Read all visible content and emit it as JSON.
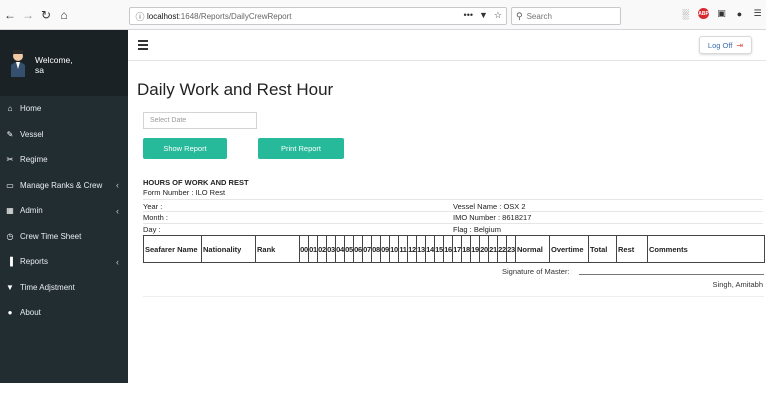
{
  "browser": {
    "back": "←",
    "forward": "→",
    "reload": "↻",
    "home": "⌂",
    "url_host": "localhost",
    "url_path": ":1648/Reports/DailyCrewReport",
    "url_more": "•••",
    "search_placeholder": "Search"
  },
  "sidebar": {
    "welcome_line1": "Welcome,",
    "welcome_line2": "sa",
    "items": [
      {
        "label": "Home",
        "icon": "home-icon",
        "glyph": "⌂",
        "chevron": ""
      },
      {
        "label": "Vessel",
        "icon": "edit-icon",
        "glyph": "✎",
        "chevron": ""
      },
      {
        "label": "Regime",
        "icon": "scissors-icon",
        "glyph": "✂",
        "chevron": ""
      },
      {
        "label": "Manage Ranks & Crew",
        "icon": "desktop-icon",
        "glyph": "▭",
        "chevron": "‹"
      },
      {
        "label": "Admin",
        "icon": "table-icon",
        "glyph": "▦",
        "chevron": "‹"
      },
      {
        "label": "Crew Time Sheet",
        "icon": "clock-icon",
        "glyph": "◷",
        "chevron": ""
      },
      {
        "label": "Reports",
        "icon": "bar-chart-icon",
        "glyph": "▐",
        "chevron": "‹"
      },
      {
        "label": "Time Adjstment",
        "icon": "filter-icon",
        "glyph": "▼",
        "chevron": ""
      },
      {
        "label": "About",
        "icon": "user-icon",
        "glyph": "●",
        "chevron": ""
      }
    ]
  },
  "header": {
    "logoff_label": "Log Off",
    "logoff_icon": "⇥"
  },
  "main": {
    "title": "Daily Work and Rest Hour",
    "date_placeholder": "Select Date",
    "show_report": "Show Report",
    "print_report": "Print Report",
    "report_heading": "HOURS OF WORK AND REST",
    "form_number": "Form Number : ILO Rest",
    "year": "Year :",
    "month": "Month :",
    "day": "Day :",
    "vessel_name": "Vessel Name : OSX 2",
    "imo_number": "IMO Number : 8618217",
    "flag": "Flag : Belgium",
    "signature_label": "Signature of Master:",
    "signature_name": "Singh, Amitabh"
  },
  "table": {
    "columns": [
      "Seafarer Name",
      "Nationality",
      "Rank",
      "00",
      "01",
      "02",
      "03",
      "04",
      "05",
      "06",
      "07",
      "08",
      "09",
      "10",
      "11",
      "12",
      "13",
      "14",
      "15",
      "16",
      "17",
      "18",
      "19",
      "20",
      "21",
      "22",
      "23",
      "Normal",
      "Overtime",
      "Total",
      "Rest",
      "Comments"
    ]
  },
  "colors": {
    "sidebar_bg": "#222d32",
    "button_green": "#26b99a",
    "logoff_icon": "#d9534f"
  }
}
